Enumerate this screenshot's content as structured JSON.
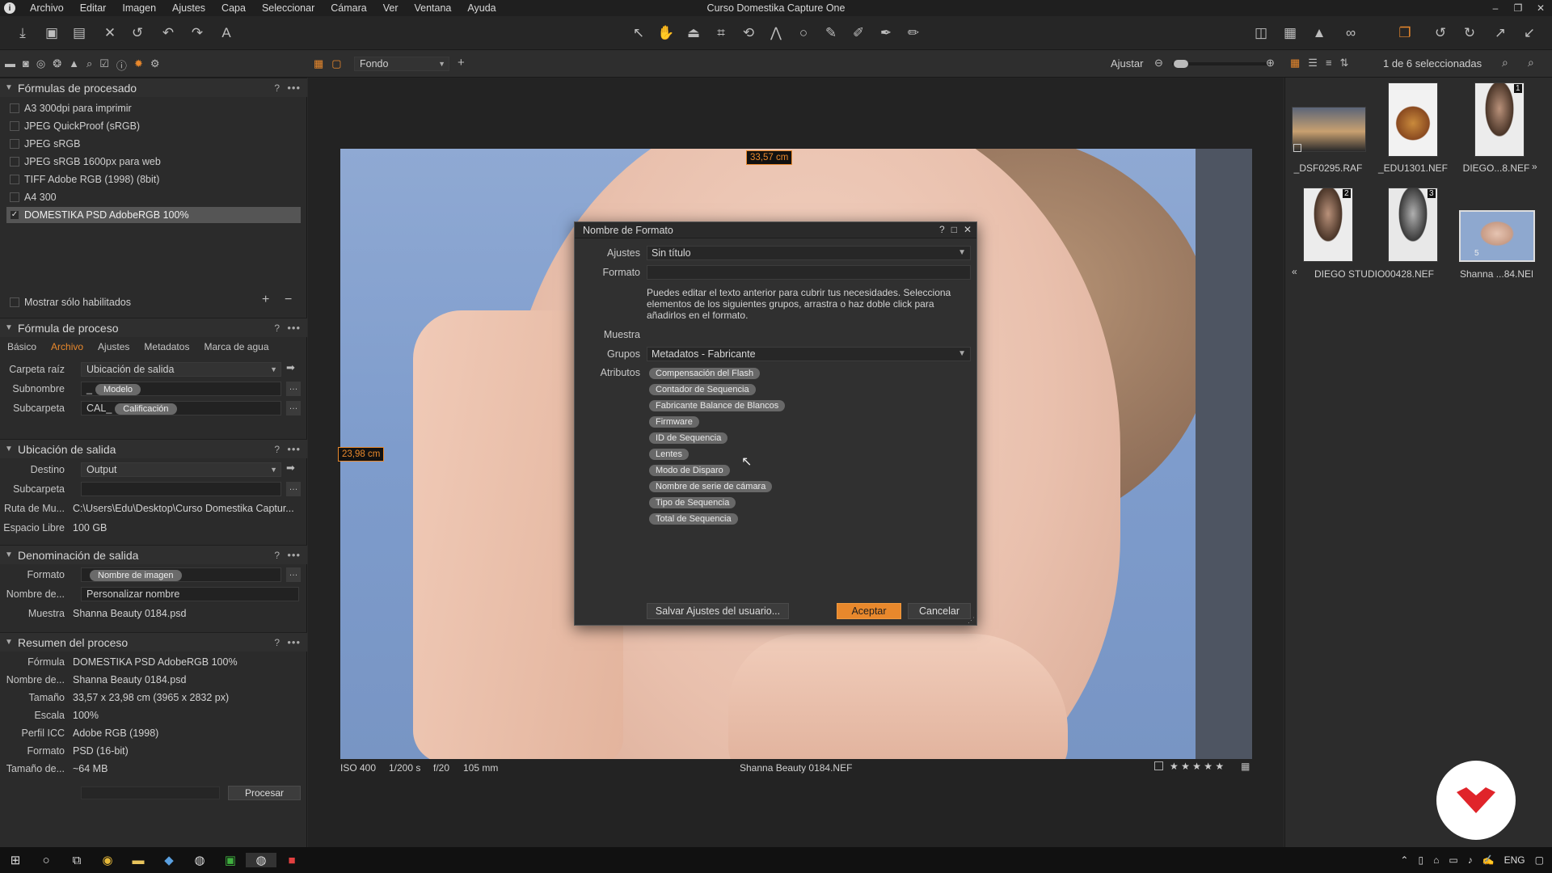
{
  "window": {
    "title": "Curso Domestika Capture One",
    "controls": [
      "–",
      "❐",
      "✕"
    ]
  },
  "menu": [
    "Archivo",
    "Editar",
    "Imagen",
    "Ajustes",
    "Capa",
    "Seleccionar",
    "Cámara",
    "Ver",
    "Ventana",
    "Ayuda"
  ],
  "viewer_bar": {
    "background_select": "Fondo",
    "fit_label": "Ajustar",
    "selection_count": "1 de 6 seleccionadas"
  },
  "recipes": {
    "title": "Fórmulas de procesado",
    "items": [
      {
        "label": "A3 300dpi para imprimir",
        "checked": false
      },
      {
        "label": "JPEG QuickProof (sRGB)",
        "checked": false
      },
      {
        "label": "JPEG sRGB",
        "checked": false
      },
      {
        "label": "JPEG sRGB 1600px para web",
        "checked": false
      },
      {
        "label": "TIFF Adobe RGB (1998) (8bit)",
        "checked": false
      },
      {
        "label": "A4 300",
        "checked": false
      },
      {
        "label": "DOMESTIKA PSD AdobeRGB 100%",
        "checked": true
      }
    ],
    "show_enabled": "Mostrar sólo habilitados"
  },
  "process_recipe": {
    "title": "Fórmula de proceso",
    "tabs": [
      "Básico",
      "Archivo",
      "Ajustes",
      "Metadatos",
      "Marca de agua"
    ],
    "active_tab": "Archivo",
    "root_label": "Carpeta raíz",
    "root_value": "Ubicación de salida",
    "subname_label": "Subnombre",
    "subname_prefix": "_",
    "subname_token": "Modelo",
    "subfolder_label": "Subcarpeta",
    "subfolder_prefix": "CAL_",
    "subfolder_token": "Calificación"
  },
  "output_location": {
    "title": "Ubicación de salida",
    "dest_label": "Destino",
    "dest_value": "Output",
    "subfolder_label": "Subcarpeta",
    "path_label": "Ruta de Mu...",
    "path_value": "C:\\Users\\Edu\\Desktop\\Curso Domestika Captur...",
    "space_label": "Espacio Libre",
    "space_value": "100 GB"
  },
  "output_naming": {
    "title": "Denominación de salida",
    "format_label": "Formato",
    "format_token": "Nombre de imagen",
    "name_label": "Nombre de...",
    "name_value": "Personalizar nombre",
    "sample_label": "Muestra",
    "sample_value": "Shanna Beauty 0184.psd"
  },
  "summary": {
    "title": "Resumen del proceso",
    "rows": [
      {
        "label": "Fórmula",
        "value": "DOMESTIKA PSD AdobeRGB 100%"
      },
      {
        "label": "Nombre de...",
        "value": "Shanna Beauty 0184.psd"
      },
      {
        "label": "Tamaño",
        "value": "33,57 x 23,98 cm (3965 x 2832 px)"
      },
      {
        "label": "Escala",
        "value": "100%"
      },
      {
        "label": "Perfil ICC",
        "value": "Adobe RGB (1998)"
      },
      {
        "label": "Formato",
        "value": "PSD (16-bit)"
      },
      {
        "label": "Tamaño de...",
        "value": "~64 MB"
      }
    ],
    "process_button": "Procesar"
  },
  "viewer": {
    "width_measure": "33,57 cm",
    "height_measure": "23,98 cm",
    "iso": "ISO 400",
    "shutter": "1/200 s",
    "aperture": "f/20",
    "focal": "105 mm",
    "filename": "Shanna Beauty 0184.NEF",
    "stars": "★ ★ ★ ★ ★"
  },
  "dialog": {
    "title": "Nombre de Formato",
    "ajustes_label": "Ajustes",
    "ajustes_value": "Sin título",
    "formato_label": "Formato",
    "help_text": "Puedes editar el texto anterior para cubrir tus necesidades. Selecciona elementos de los siguientes grupos, arrastra o haz doble click para añadirlos en el formato.",
    "muestra_label": "Muestra",
    "grupos_label": "Grupos",
    "grupos_value": "Metadatos - Fabricante",
    "atributos_label": "Atributos",
    "attributes": [
      "Compensación del Flash",
      "Contador de Sequencia",
      "Fabricante Balance de Blancos",
      "Firmware",
      "ID de Sequencia",
      "Lentes",
      "Modo de Disparo",
      "Nombre de serie de cámara",
      "Tipo de Sequencia",
      "Total de Sequencia"
    ],
    "save_button": "Salvar Ajustes del usuario...",
    "ok_button": "Aceptar",
    "cancel_button": "Cancelar"
  },
  "browser": {
    "thumbs": [
      {
        "caption": "_DSF0295.RAF"
      },
      {
        "caption": "_EDU1301.NEF"
      },
      {
        "caption": "DIEGO...8.NEF"
      },
      {
        "caption": "DIEGO STUDIO00428.NEF"
      },
      {
        "caption": ""
      },
      {
        "caption": "Shanna ...84.NEF"
      }
    ],
    "badge_1": "1",
    "badge_2": "2",
    "badge_3": "3",
    "badge_5": "5"
  },
  "taskbar": {
    "lang": "ENG"
  },
  "colors": {
    "accent": "#e8882c",
    "brand_red": "#e0242a"
  }
}
